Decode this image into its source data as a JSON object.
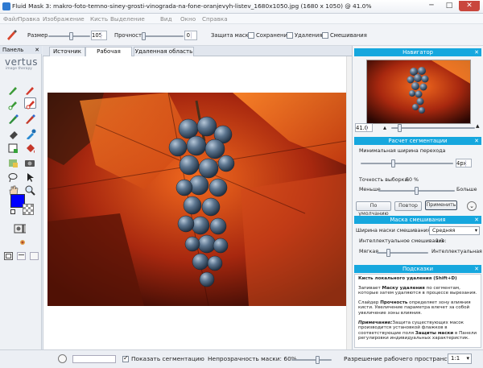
{
  "window": {
    "title": "Fluid Mask 3: makro-foto-temno-siney-grosti-vinograda-na-fone-oranjevyh-listev_1680x1050.jpg (1680 x 1050) @ 41.0%",
    "min": "─",
    "max": "□",
    "close": "✕"
  },
  "menu": [
    "Файл",
    "Правка",
    "Изображение",
    "Кисть",
    "Выделение",
    "Вид",
    "Окно",
    "Справка"
  ],
  "toolbar": {
    "size_label": "Размер",
    "size_value": "105",
    "strength_label": "Прочность",
    "strength_value": "0",
    "protect_label": "Защита маски:",
    "opt_save": "Сохранения",
    "opt_delete": "Удаления",
    "opt_blend": "Смешивания"
  },
  "panel": {
    "title": "Панель",
    "brand": "vertus",
    "brand_sub": "image therapy"
  },
  "tabs": [
    "Источник",
    "Рабочая область",
    "Удаленная область"
  ],
  "navigator": {
    "title": "Навигатор",
    "zoom": "41.0"
  },
  "segmentation": {
    "title": "Расчет сегментации",
    "min_width_label": "Минимальная ширина перехода",
    "min_width_value": "4px",
    "accuracy_label": "Точность выборки:",
    "accuracy_value": "50 %",
    "less": "Меньше",
    "more": "Больше",
    "btn_default": "По умолчанию",
    "btn_repeat": "Повтор",
    "btn_apply": "Применить"
  },
  "blend": {
    "title": "Маска смешивания",
    "width_label": "Ширина маски смешивания:",
    "width_value": "Средняя",
    "smart_label": "Интеллектуальное смешивание:",
    "smart_value": "1:3",
    "soft": "Мягкая",
    "smart": "Интеллектуальная"
  },
  "hints": {
    "title": "Подсказки",
    "heading": "Кисть локального удаления (Shift+D)",
    "p1a": "Запивает ",
    "p1b": "Маску удаления",
    "p1c": " по сегментам,",
    "p1d": "которые затем удаляются в процессе вырезания.",
    "p2a": "Слайдер ",
    "p2b": "Прочность",
    "p2c": " определяет зону влияния",
    "p2d": "кисти. Увеличение параметра влечет за собой",
    "p2e": "увеличение зоны влияния.",
    "p3a": "Примечание:",
    "p3b": "Защита существующих масок",
    "p3c": "производится установкой флажков в",
    "p3d": "соответствующие поля ",
    "p3e": "Защиты маски",
    "p3f": " в Панели",
    "p3g": "регулировки индивидуальных характеристик."
  },
  "status": {
    "show_seg": "Показать сегментацию",
    "opacity": "Непрозрачность маски: 60%",
    "resolution": "Разрешение рабочего пространства:",
    "res_value": "1:1"
  },
  "colors": {
    "accent": "#16a7de",
    "fg_swatch": "#0000ff"
  }
}
